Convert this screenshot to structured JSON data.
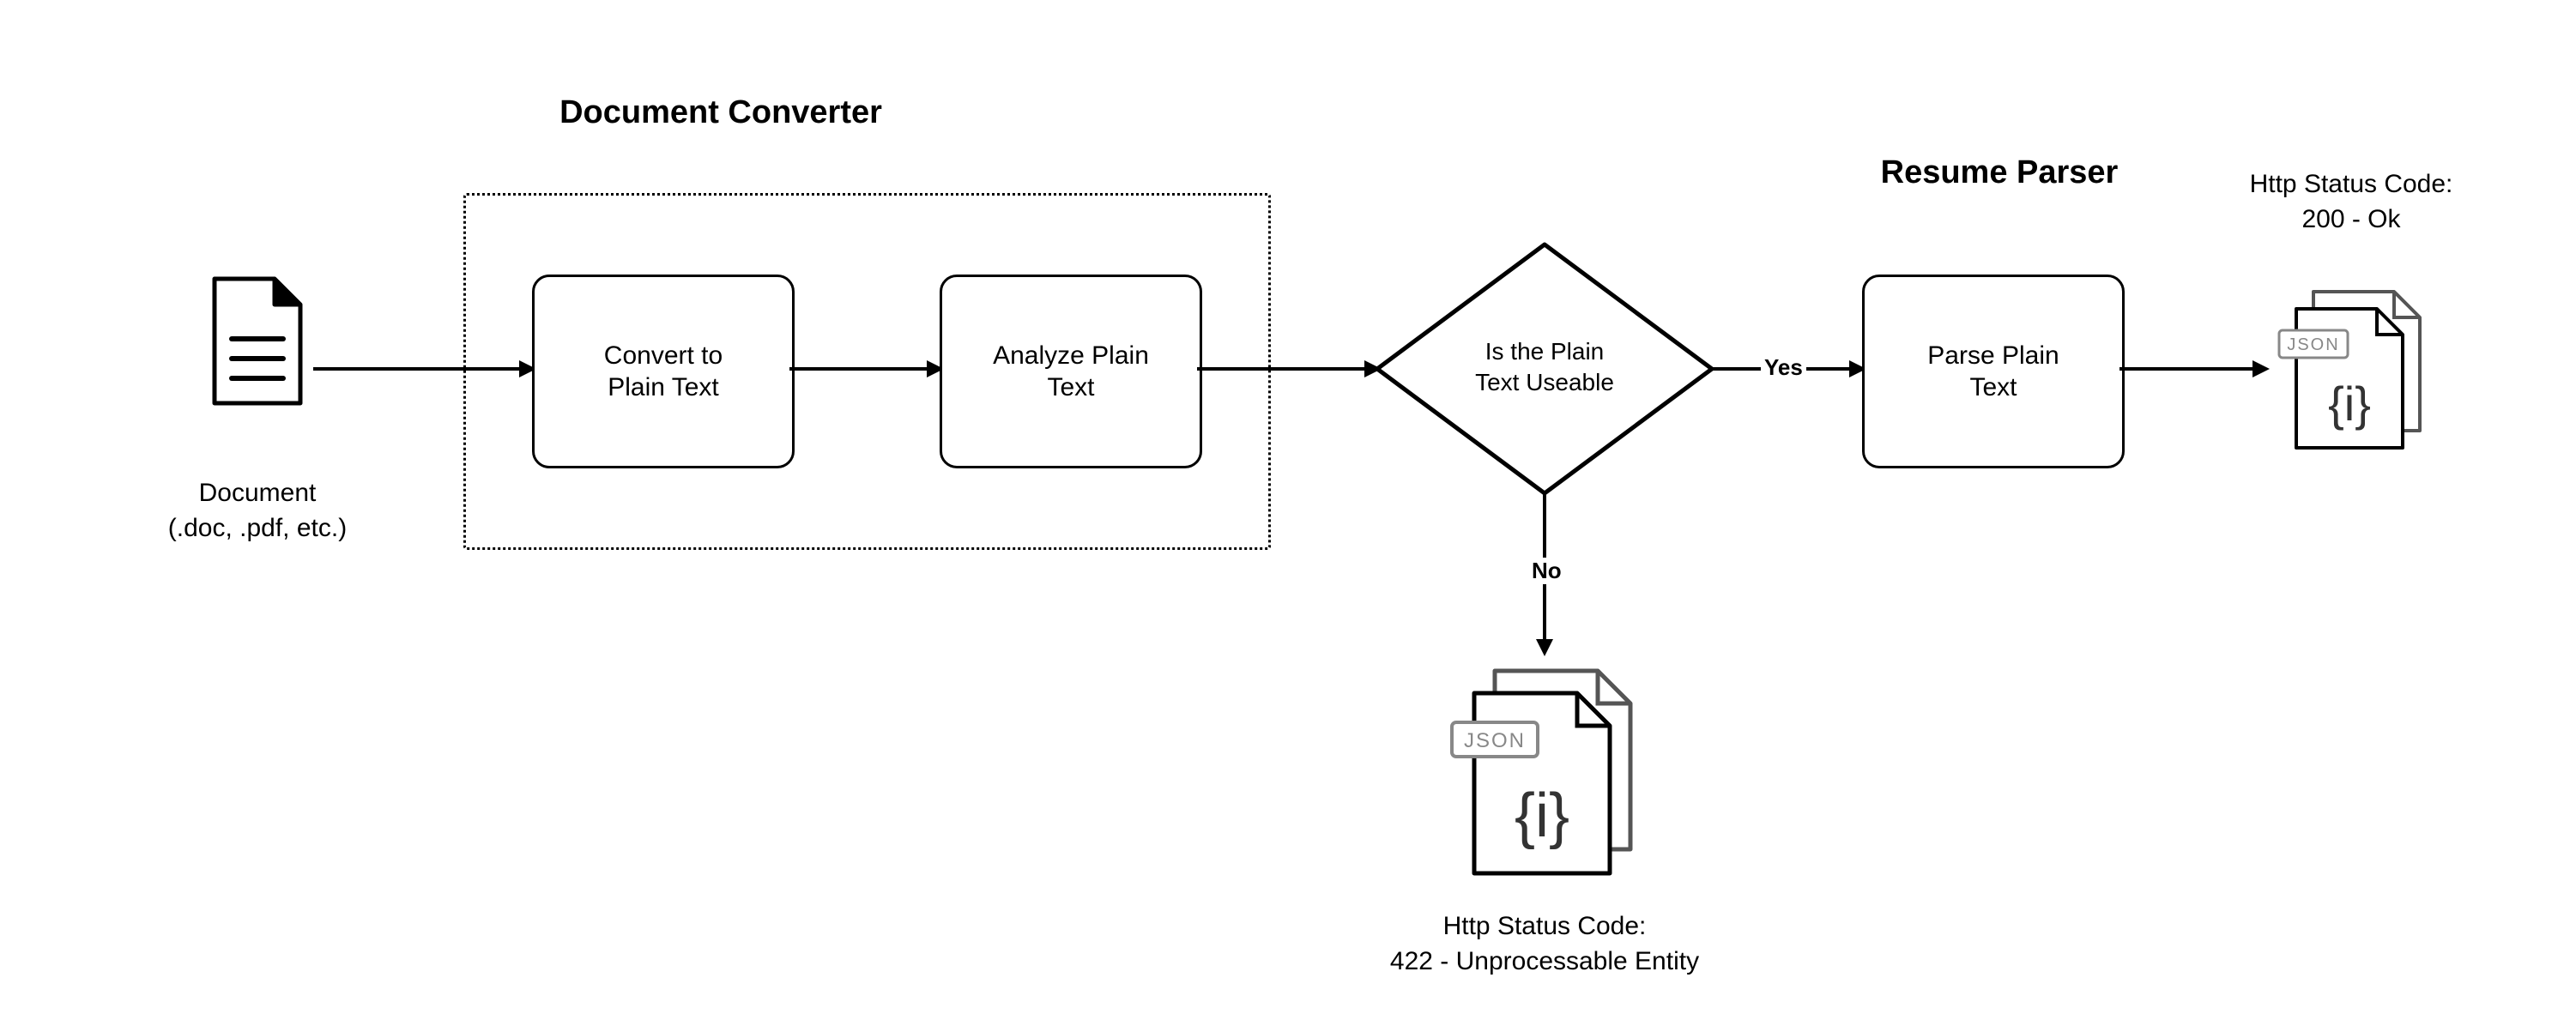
{
  "groups": {
    "converter_title": "Document Converter",
    "parser_title": "Resume Parser"
  },
  "nodes": {
    "input_doc_line1": "Document",
    "input_doc_line2": "(.doc, .pdf, etc.)",
    "convert_box": "Convert to\nPlain Text",
    "analyze_box": "Analyze Plain\nText",
    "decision": "Is the Plain\nText Useable",
    "parse_box": "Parse Plain\nText"
  },
  "edges": {
    "yes": "Yes",
    "no": "No"
  },
  "outputs": {
    "ok_line1": "Http Status Code:",
    "ok_line2": "200 - Ok",
    "fail_line1": "Http Status Code:",
    "fail_line2": "422 - Unprocessable Entity",
    "json_badge": "JSON",
    "json_body": "{i}"
  }
}
